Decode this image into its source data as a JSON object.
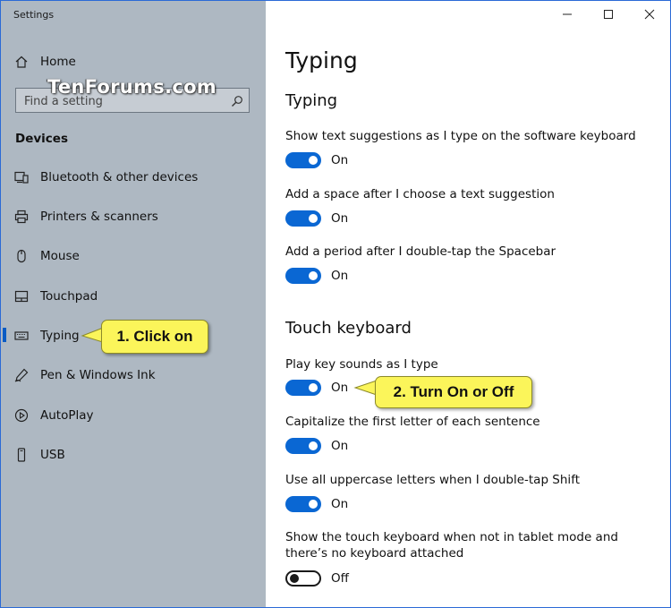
{
  "window": {
    "title": "Settings",
    "controls": {
      "minimize": "minimize-icon",
      "maximize": "maximize-icon",
      "close": "close-icon"
    }
  },
  "watermark": "TenForums.com",
  "sidebar": {
    "home_label": "Home",
    "search": {
      "placeholder": "Find a setting",
      "value": ""
    },
    "section": "Devices",
    "items": [
      {
        "label": "Bluetooth & other devices",
        "icon": "bluetooth-devices-icon"
      },
      {
        "label": "Printers & scanners",
        "icon": "printer-icon"
      },
      {
        "label": "Mouse",
        "icon": "mouse-icon"
      },
      {
        "label": "Touchpad",
        "icon": "touchpad-icon"
      },
      {
        "label": "Typing",
        "icon": "keyboard-icon",
        "selected": true
      },
      {
        "label": "Pen & Windows Ink",
        "icon": "pen-icon"
      },
      {
        "label": "AutoPlay",
        "icon": "autoplay-icon"
      },
      {
        "label": "USB",
        "icon": "usb-icon"
      }
    ]
  },
  "main": {
    "title": "Typing",
    "sections": [
      {
        "heading": "Typing",
        "settings": [
          {
            "label": "Show text suggestions as I type on the software keyboard",
            "state": "On"
          },
          {
            "label": "Add a space after I choose a text suggestion",
            "state": "On"
          },
          {
            "label": "Add a period after I double-tap the Spacebar",
            "state": "On"
          }
        ]
      },
      {
        "heading": "Touch keyboard",
        "settings": [
          {
            "label": "Play key sounds as I type",
            "state": "On"
          },
          {
            "label": "Capitalize the first letter of each sentence",
            "state": "On"
          },
          {
            "label": "Use all uppercase letters when I double-tap Shift",
            "state": "On"
          },
          {
            "label": "Show the touch keyboard when not in tablet mode and there’s no keyboard attached",
            "state": "Off"
          }
        ]
      }
    ]
  },
  "callouts": [
    {
      "text": "1. Click on"
    },
    {
      "text": "2. Turn On or Off"
    }
  ],
  "colors": {
    "accent": "#0a67d3",
    "sidebar_bg": "#aeb8c2",
    "callout_bg": "#fbf55a"
  }
}
